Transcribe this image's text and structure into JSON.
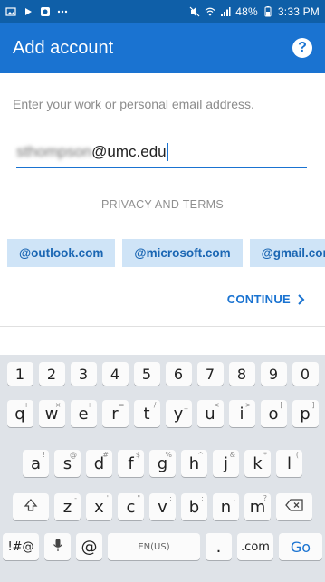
{
  "status_bar": {
    "left_icons": [
      "image-icon",
      "play-icon",
      "app-icon",
      "more-icon"
    ],
    "right_icons": [
      "mute-icon",
      "wifi-icon",
      "signal-icon"
    ],
    "battery": "48%",
    "time": "3:33 PM"
  },
  "app_bar": {
    "title": "Add account",
    "help_label": "?"
  },
  "form": {
    "prompt": "Enter your work or personal email address.",
    "email_prefix_blurred": "sthompson",
    "email_domain": "@umc.edu",
    "privacy": "PRIVACY AND TERMS",
    "chips": [
      "@outlook.com",
      "@microsoft.com",
      "@gmail.com"
    ],
    "continue_label": "CONTINUE"
  },
  "keyboard": {
    "row_numbers": [
      "1",
      "2",
      "3",
      "4",
      "5",
      "6",
      "7",
      "8",
      "9",
      "0"
    ],
    "row1": [
      {
        "key": "q",
        "hint": "+"
      },
      {
        "key": "w",
        "hint": "×"
      },
      {
        "key": "e",
        "hint": "÷"
      },
      {
        "key": "r",
        "hint": "="
      },
      {
        "key": "t",
        "hint": "/"
      },
      {
        "key": "y",
        "hint": "_"
      },
      {
        "key": "u",
        "hint": "<"
      },
      {
        "key": "i",
        "hint": ">"
      },
      {
        "key": "o",
        "hint": "["
      },
      {
        "key": "p",
        "hint": "]"
      }
    ],
    "row2": [
      {
        "key": "a",
        "hint": "!"
      },
      {
        "key": "s",
        "hint": "@"
      },
      {
        "key": "d",
        "hint": "#"
      },
      {
        "key": "f",
        "hint": "$"
      },
      {
        "key": "g",
        "hint": "%"
      },
      {
        "key": "h",
        "hint": "^"
      },
      {
        "key": "j",
        "hint": "&"
      },
      {
        "key": "k",
        "hint": "*"
      },
      {
        "key": "l",
        "hint": "("
      }
    ],
    "row3": [
      {
        "key": "z",
        "hint": "-"
      },
      {
        "key": "x",
        "hint": "'"
      },
      {
        "key": "c",
        "hint": "\""
      },
      {
        "key": "v",
        "hint": ":"
      },
      {
        "key": "b",
        "hint": ";"
      },
      {
        "key": "n",
        "hint": ","
      },
      {
        "key": "m",
        "hint": "?"
      }
    ],
    "symbols_label": "!#@",
    "mic_label": "mic",
    "at_label": "@",
    "space_label": "EN(US)",
    "dot_label": ".",
    "dotcom_label": ".com",
    "go_label": "Go"
  }
}
